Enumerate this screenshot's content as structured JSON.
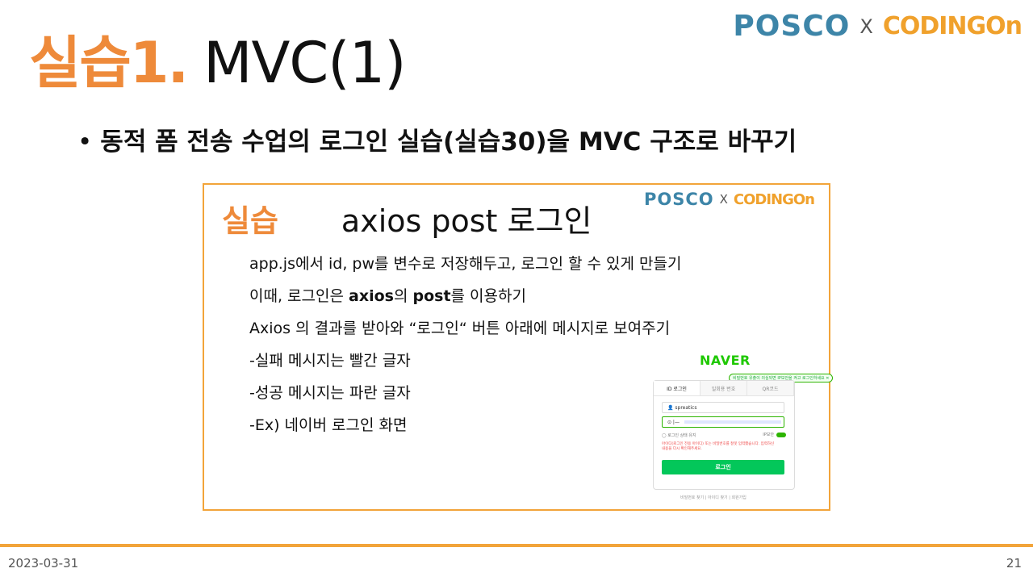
{
  "slide": {
    "title_accent": "실습1.",
    "title_main": "MVC(1)",
    "logo": {
      "posco": "POSCO",
      "x": "X",
      "coding": "CODINGOn"
    },
    "bullet": "동적 폼 전송 수업의 로그인 실습(실습30)을 MVC 구조로 바꾸기"
  },
  "inner": {
    "accent": "실습",
    "title": "axios post 로그인",
    "logo": {
      "posco": "POSCO",
      "x": "X",
      "coding": "CODINGOn"
    },
    "lines": [
      {
        "parts": [
          "app.js에서 id, pw를 변수로 저장해두고, 로그인 할 수 있게 만들기"
        ]
      },
      {
        "parts": [
          "이때, 로그인은 ",
          "axios",
          "의 ",
          "post",
          "를 이용하기"
        ]
      },
      {
        "parts": [
          "Axios 의 결과를 받아와 “로그인“ 버튼  아래에 메시지로 보여주기"
        ]
      },
      {
        "parts": [
          "-실패 메시지는 빨간 글자"
        ]
      },
      {
        "parts": [
          "-성공 메시지는 파란 글자"
        ]
      },
      {
        "parts": [
          "-Ex) 네이버 로그인 화면"
        ]
      }
    ]
  },
  "naver": {
    "brand": "NAVER",
    "bubble": "비밀번호 유출이 의심되면 IP보안을 켜고 로그인하세요 ✕",
    "tabs": [
      "ID 로그인",
      "일회용 번호",
      "QR코드"
    ],
    "id_value": "spreatics",
    "pw_prefix": "⊙ |—",
    "stay_label": "로그인 상태 유지",
    "ip_label": "IP보안",
    "error_text": "아이디(로그인 전용 아이디) 또는 비밀번호를 잘못 입력했습니다. 입력하신 내용을 다시 확인해주세요.",
    "login_button": "로그인",
    "links": "비밀번호 찾기  |  아이디 찾기  |  회원가입"
  },
  "footer": {
    "date": "2023-03-31",
    "page": "21"
  },
  "colors": {
    "accent": "#ee8a3a",
    "border": "#f2a43a",
    "naver_green": "#03c75a",
    "posco_blue": "#3d85a8"
  }
}
